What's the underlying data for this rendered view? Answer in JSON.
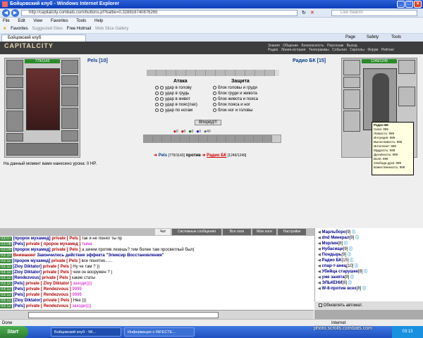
{
  "window": {
    "title": "Бойцовский клуб - Windows Internet Explorer"
  },
  "browser": {
    "address": "http://capitalcity.combats.com/buttons.pl?battle=0.328818740876265",
    "search_placeholder": "Live Search",
    "menu": [
      "File",
      "Edit",
      "View",
      "Favorites",
      "Tools",
      "Help"
    ],
    "favorites": "Favorites",
    "fav_links": [
      "Suggested Sites",
      "Free Hotmail",
      "Web Slice Gallery"
    ],
    "tab_title": "Бойцовский клуб",
    "right_tools": [
      "Page",
      "Safety",
      "Tools"
    ]
  },
  "game": {
    "logo": "CAPITALCITY",
    "nav_top": [
      "Знания",
      "Общение",
      "Безопасность",
      "Персонаж",
      "Выход"
    ],
    "nav_bottom": [
      "Радио",
      "Линия-история",
      "Телеграммы",
      "События",
      "Скроллы",
      "Форум",
      "Рейтинг"
    ],
    "player": {
      "name": "Pels [10]",
      "hp": "779/1143"
    },
    "enemy": {
      "name": "Радио БК [15]",
      "hp": "1249/1249"
    },
    "attack_title": "Атака",
    "defense_title": "Защита",
    "attack_options": [
      "удар в голову",
      "удар в грудь",
      "удар в живот",
      "удар в пояс(пах)",
      "удар по ногам"
    ],
    "defense_options": [
      "блок головы и груди",
      "блок груди и живота",
      "блок живота и пояса",
      "блок пояса и ног",
      "блок ног и головы"
    ],
    "go_button": "Вперёд!!!",
    "stats": [
      "0",
      "0",
      "0",
      "0",
      "40"
    ],
    "versus_player": "Pels",
    "versus_player_hp": "[779/1143]",
    "versus_word": "против",
    "versus_enemy": "Радио БК",
    "versus_enemy_hp": "[1249/1249]",
    "damage_text": "На данный момент вами нанесено урона: 0 HP.",
    "tooltip": {
      "name": "Радио БК",
      "lines": [
        "Сила: 999",
        "Ловкость: 999",
        "Интуиция: 999",
        "Выносливость: 999",
        "Интеллект: 999",
        "Мудрость: 999",
        "Духовность: 999",
        "Воля: 999",
        "Свобода духа: 999",
        "Божественность: 999"
      ]
    }
  },
  "chat": {
    "tabs": [
      "Чат",
      "Системные сообщения",
      "Все логи",
      "Мои логи",
      "Настройки"
    ],
    "messages": [
      {
        "time": "03:07",
        "user": "[пророк мухамед]",
        "pv": "private [ Pels ]",
        "text": "так я не понял ты пр",
        "style": "m"
      },
      {
        "time": "03:08",
        "user": "[Pels]",
        "pv": "private [ пророк мухамед ]",
        "text": "тыма",
        "style": "mp"
      },
      {
        "time": "03:09",
        "user": "[пророк мухамед]",
        "pv": "private [ Pels ]",
        "text": "а зачем против лезешь? тем более там просветлый был(",
        "style": "m"
      },
      {
        "time": "03:10",
        "user": "",
        "pv": "Внимание!",
        "text": "Закончилось действие эффекта \"Эликсир Восстановления\"",
        "style": "mb"
      },
      {
        "time": "03:11",
        "user": "[пророк мухамед]",
        "pv": "private [ Pels ]",
        "text": "все понятно......",
        "style": "m"
      },
      {
        "time": "03:11",
        "user": "[Zloy Diktator]",
        "pv": "private [ Pels ]",
        "text": "Ну че там ? ))",
        "style": "m"
      },
      {
        "time": "03:11",
        "user": "[Zloy Diktator]",
        "pv": "private [ Pels ]",
        "text": "чем он вооружен ? )",
        "style": "m"
      },
      {
        "time": "03:11",
        "user": "[Rendezvous]",
        "pv": "private [ Pels ]",
        "text": "какие статы",
        "style": "m"
      },
      {
        "time": "03:11",
        "user": "[Pels]",
        "pv": "private [ Zloy Diktator ]",
        "text": "заходи))))",
        "style": "mp"
      },
      {
        "time": "03:12",
        "user": "[Pels]",
        "pv": "private [ Rendezvous ]",
        "text": "9999",
        "style": "mp"
      },
      {
        "time": "03:12",
        "user": "[Pels]",
        "pv": "private [ Rendezvous ]",
        "text": "9999",
        "style": "mp"
      },
      {
        "time": "03:12",
        "user": "[Zloy Diktator]",
        "pv": "private [ Pels ]",
        "text": "Нее )))",
        "style": "m"
      },
      {
        "time": "03:12",
        "user": "[Pels]",
        "pv": "private [ Rendezvous ]",
        "text": "заходи))))",
        "style": "mp"
      },
      {
        "time": "03:13",
        "user": "[Rendezvous]",
        "pv": "private [ Pels ]",
        "text": "чота мне ссыкатно) 2-е суток отдыхать",
        "style": "m"
      },
      {
        "time": "03:13",
        "user": "[Rendezvous]",
        "pv": "private [ Pels ]",
        "text": "образ какое? скрин сделай",
        "style": "m"
      }
    ],
    "users": [
      {
        "name": "Марльборо",
        "lvl": "[9]"
      },
      {
        "name": "dnd Минерал",
        "lvl": "[9]"
      },
      {
        "name": "Мэрлин",
        "lvl": "[8]"
      },
      {
        "name": "Нубасище",
        "lvl": "[9]"
      },
      {
        "name": "Пондырь",
        "lvl": "[9]"
      },
      {
        "name": "Радио БК",
        "lvl": "[15]"
      },
      {
        "name": "спар-т-анец",
        "lvl": "[10]"
      },
      {
        "name": "Убийца старушек",
        "lvl": "[8]"
      },
      {
        "name": "уже занята",
        "lvl": "[9]"
      },
      {
        "name": "ЭЛЬКЕНИ",
        "lvl": "[8]"
      },
      {
        "name": "W-8-против всех",
        "lvl": "[8]"
      }
    ],
    "update_label": "Обновлять автомат."
  },
  "statusbar": {
    "left": "Done",
    "right": "Internet"
  },
  "taskbar": {
    "start": "Start",
    "tasks": [
      "Бойцовский клуб - Wi...",
      "Информация о INFECTE..."
    ],
    "clock": "03:13"
  },
  "watermark": "photo.scrolls.combats.com"
}
